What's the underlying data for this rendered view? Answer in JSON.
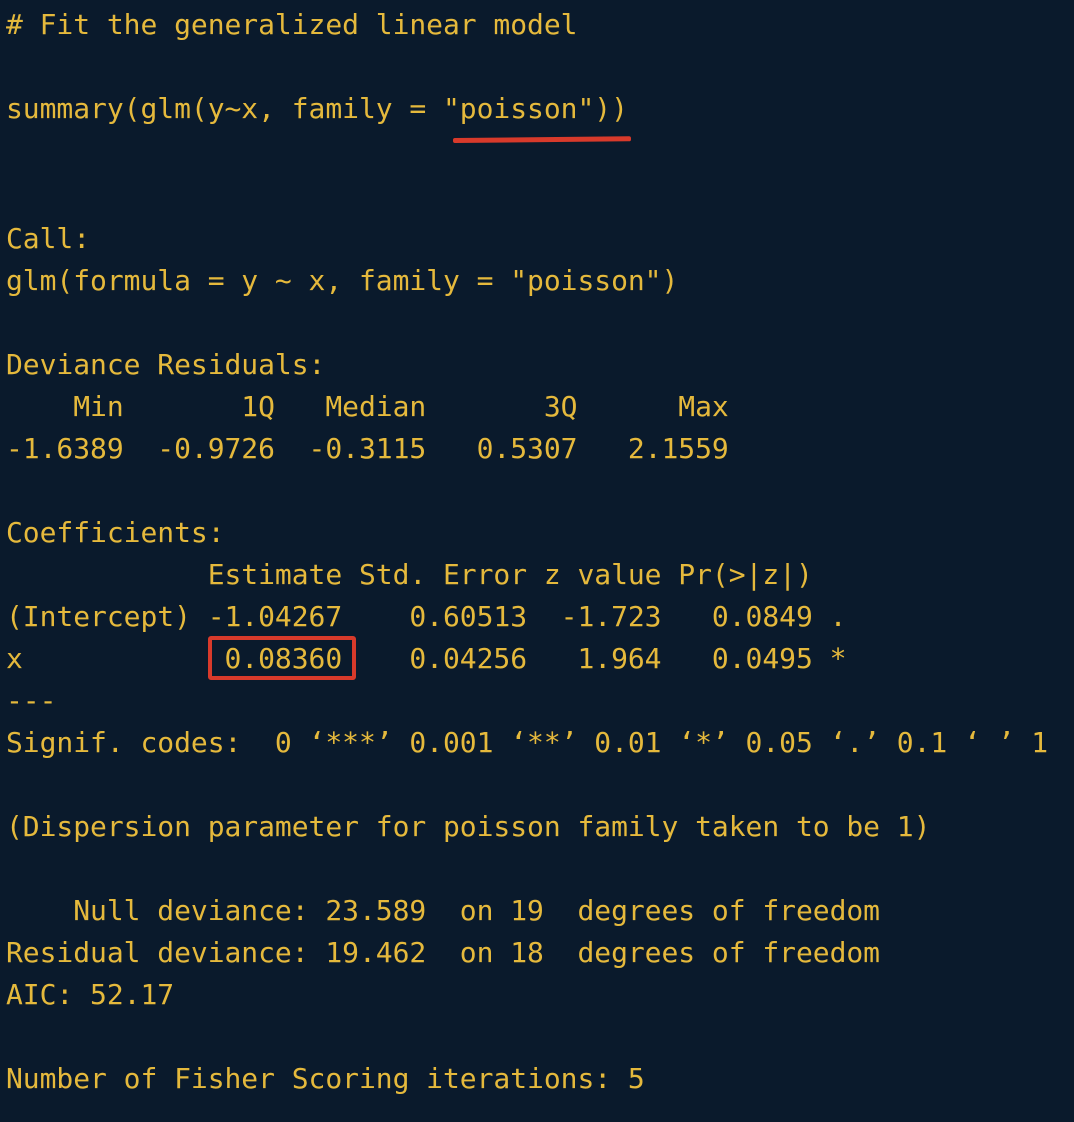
{
  "colors": {
    "background": "#0a1a2c",
    "text": "#e5b93c",
    "annotation": "#d83a2b"
  },
  "console": {
    "lines": [
      "# Fit the generalized linear model",
      "",
      "summary(glm(y~x, family = \"poisson\"))",
      "",
      "",
      "Call:",
      "glm(formula = y ~ x, family = \"poisson\")",
      "",
      "Deviance Residuals:",
      "    Min       1Q   Median       3Q      Max  ",
      "-1.6389  -0.9726  -0.3115   0.5307   2.1559  ",
      "",
      "Coefficients:",
      "            Estimate Std. Error z value Pr(>|z|)  ",
      "(Intercept) -1.04267    0.60513  -1.723   0.0849 .",
      "x            0.08360    0.04256   1.964   0.0495 *",
      "---",
      "Signif. codes:  0 ‘***’ 0.001 ‘**’ 0.01 ‘*’ 0.05 ‘.’ 0.1 ‘ ’ 1",
      "",
      "(Dispersion parameter for poisson family taken to be 1)",
      "",
      "    Null deviance: 23.589  on 19  degrees of freedom",
      "Residual deviance: 19.462  on 18  degrees of freedom",
      "AIC: 52.17",
      "",
      "Number of Fisher Scoring iterations: 5"
    ]
  }
}
